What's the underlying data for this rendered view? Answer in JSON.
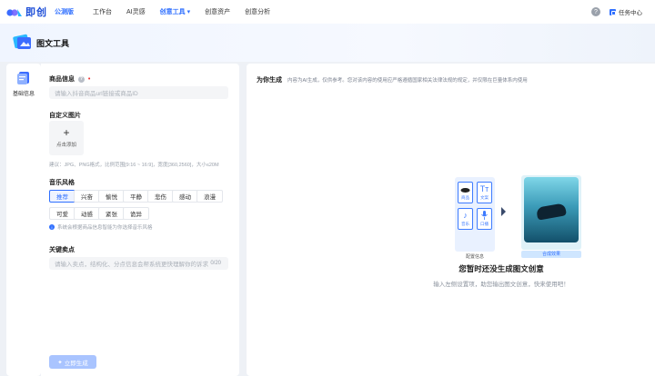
{
  "topnav": {
    "brand": "即创",
    "version_badge": "公测版",
    "items": [
      {
        "label": "工作台"
      },
      {
        "label": "AI灵感"
      },
      {
        "label": "创意工具 ▾"
      },
      {
        "label": "创意资产"
      },
      {
        "label": "创意分析"
      }
    ],
    "help_icon": "?",
    "task_center": "任务中心"
  },
  "page": {
    "title": "图文工具"
  },
  "sidebar": {
    "items": [
      {
        "label": "基础信息",
        "icon": "document-icon"
      }
    ]
  },
  "form": {
    "product_info_label": "商品信息",
    "product_info_placeholder": "请输入抖音商品url链接或商品ID",
    "custom_image_label": "自定义图片",
    "upload_plus": "+",
    "upload_label": "点击添加",
    "upload_hint": "建议：JPG、PNG格式，比例范围[9:16 ~ 16:9]，宽度[360,2560]，大小≤20M",
    "music_style_label": "音乐风格",
    "music_styles": [
      {
        "label": "推荐"
      },
      {
        "label": "兴奋"
      },
      {
        "label": "愉悦"
      },
      {
        "label": "平静"
      },
      {
        "label": "悲伤"
      },
      {
        "label": "感动"
      },
      {
        "label": "浪漫"
      },
      {
        "label": "可爱"
      },
      {
        "label": "动感"
      },
      {
        "label": "紧张"
      },
      {
        "label": "诡异"
      }
    ],
    "music_selected": "推荐",
    "music_note": "系统会根据商品信息智能为你选择音乐风格",
    "key_points_label": "关键卖点",
    "key_points_placeholder": "请输入卖点，结构化、分点信息会帮系统更快理解你的诉求",
    "key_points_counter": "0/20",
    "generate_button": "立即生成"
  },
  "result": {
    "title": "为你生成",
    "disclaimer": "内容为AI生成，仅供参考。您对该内容的使用应严格遵循国家相关法律法规的规定，并仅限在巨量体系内使用",
    "card_labels": [
      "商品",
      "文案",
      "音乐",
      "口播"
    ],
    "caption_left": "配置信息",
    "caption_right": "合成效果",
    "empty_title": "您暂时还没生成图文创意",
    "empty_sub": "输入左侧设置项，助您输出图文创意，快来使用吧！"
  },
  "colors": {
    "accent": "#2f6fff",
    "generate_disabled": "#a9c4ff"
  }
}
